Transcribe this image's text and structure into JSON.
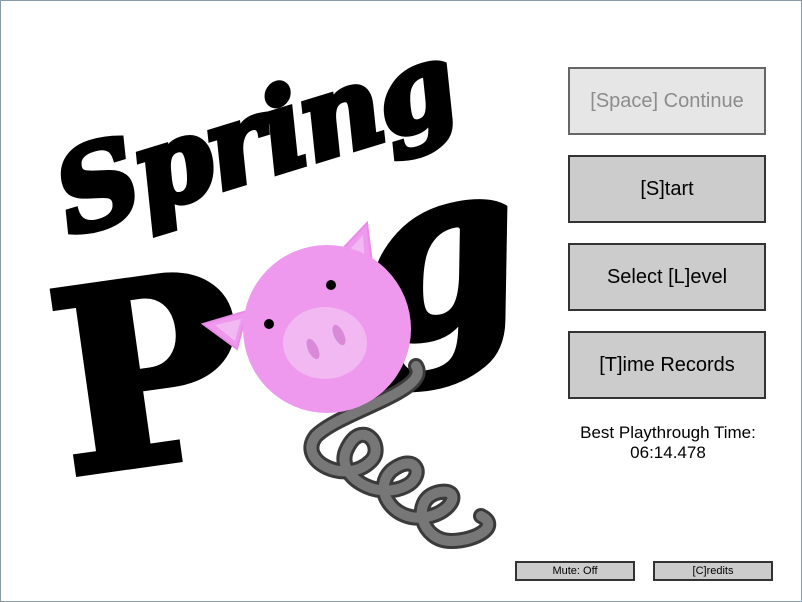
{
  "logo": {
    "word_top": "Spring",
    "word_bottom_first": "P",
    "word_bottom_last": "g",
    "colors": {
      "text": "#000000",
      "pig": "#ee99ee",
      "snout": "#f2b8f2",
      "spring": "#6b6b6b"
    }
  },
  "menu": {
    "continue_label": "[Space] Continue",
    "start_label": "[S]tart",
    "level_label": "Select [L]evel",
    "records_label": "[T]ime Records"
  },
  "best_time": {
    "label": "Best Playthrough Time:",
    "value": "06:14.478"
  },
  "footer": {
    "mute_label": "Mute: Off",
    "credits_label": "[C]redits"
  },
  "colors": {
    "button_bg": "#cccccc",
    "button_disabled_bg": "#e6e6e6",
    "button_border": "#333333"
  }
}
